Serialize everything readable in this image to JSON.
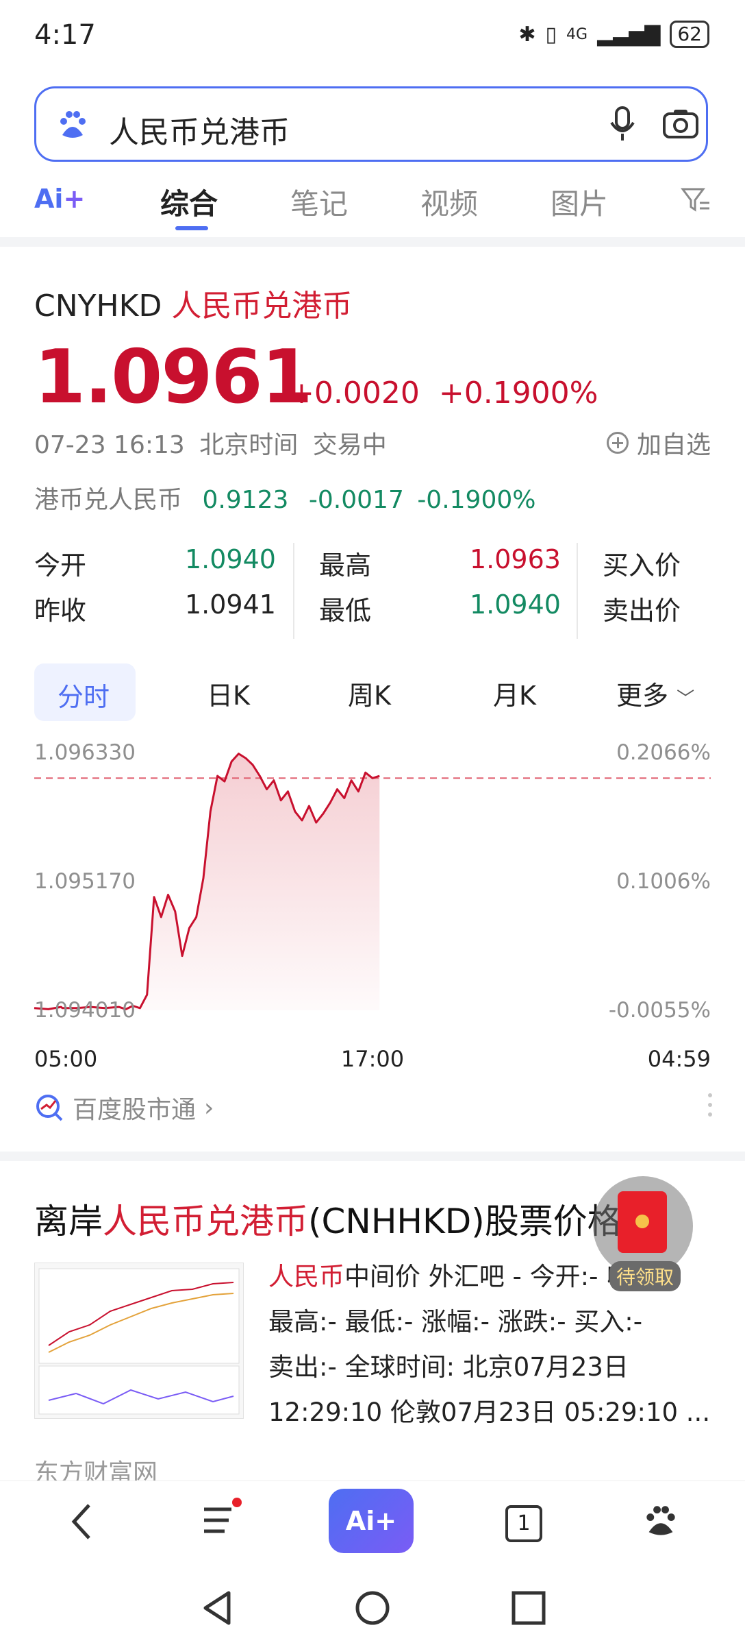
{
  "status_bar": {
    "time": "4:17",
    "network": "4G",
    "battery": "62"
  },
  "search": {
    "query": "人民币兑港币"
  },
  "tabs": [
    {
      "label": "综合",
      "active": true
    },
    {
      "label": "笔记",
      "active": false
    },
    {
      "label": "视频",
      "active": false
    },
    {
      "label": "图片",
      "active": false
    }
  ],
  "quote": {
    "code": "CNYHKD",
    "name": "人民币兑港币",
    "price": "1.0961",
    "change": "+0.0020",
    "change_pct": "+0.1900%",
    "time": "07-23 16:13",
    "tz": "北京时间",
    "status": "交易中",
    "add_watch": "加自选",
    "reverse_label": "港币兑人民币",
    "reverse_price": "0.9123",
    "reverse_change": "-0.0017",
    "reverse_change_pct": "-0.1900%"
  },
  "stats": {
    "open_label": "今开",
    "open": "1.0940",
    "prev_label": "昨收",
    "prev": "1.0941",
    "high_label": "最高",
    "high": "1.0963",
    "low_label": "最低",
    "low": "1.0940",
    "bid_label": "买入价",
    "ask_label": "卖出价"
  },
  "chart_tabs": [
    "分时",
    "日K",
    "周K",
    "月K",
    "更多"
  ],
  "chart_data": {
    "type": "line",
    "y_left_ticks": [
      "1.096330",
      "1.095170",
      "1.094010"
    ],
    "y_right_ticks": [
      "0.2066%",
      "0.1006%",
      "-0.0055%"
    ],
    "x_ticks": [
      "05:00",
      "17:00",
      "04:59"
    ],
    "ylim": [
      1.09401,
      1.09633
    ],
    "reference_line": 1.0961,
    "grid": false,
    "series": [
      {
        "x": [
          0,
          0.5,
          0.95,
          1.0,
          1.5,
          2.0,
          2.5,
          3.0,
          3.25,
          3.5,
          3.75,
          4.0,
          4.25,
          4.5,
          4.75,
          5.0,
          5.25,
          5.5,
          5.75,
          6.0,
          6.25,
          6.5,
          6.75,
          7.0,
          7.25,
          7.5,
          7.75,
          8.0,
          8.25,
          8.5,
          8.75,
          9.0,
          9.25,
          9.5,
          9.75,
          10.0,
          10.25,
          10.5,
          10.75,
          11.0,
          11.25,
          11.5,
          11.75,
          12.0,
          12.25
        ],
        "values": [
          1.09403,
          1.09402,
          1.09404,
          1.09403,
          1.09403,
          1.09404,
          1.09403,
          1.09404,
          1.09402,
          1.09405,
          1.09403,
          1.09415,
          1.09503,
          1.09485,
          1.09505,
          1.0949,
          1.0945,
          1.09475,
          1.09485,
          1.0952,
          1.0958,
          1.09612,
          1.09607,
          1.09625,
          1.09632,
          1.09628,
          1.09622,
          1.09612,
          1.096,
          1.09608,
          1.0959,
          1.09598,
          1.0958,
          1.09572,
          1.09585,
          1.0957,
          1.09578,
          1.09588,
          1.096,
          1.09592,
          1.09608,
          1.09598,
          1.09615,
          1.0961,
          1.09612
        ]
      }
    ]
  },
  "source_link": "百度股市通",
  "result": {
    "title_prefix": "离岸",
    "title_highlight": "人民币兑港币",
    "title_suffix": "(CNHHKD)股票价格",
    "ellipsis": "..",
    "body_highlight": "人民币",
    "body_line1_rest": "中间价 外汇吧 - 今开:- 收:-",
    "body_line2": "最高:- 最低:- 涨幅:- 涨跌:- 买入:-",
    "body_line3": "卖出:- 全球时间: 北京07月23日",
    "body_line4": "12:29:10 伦敦07月23日 05:29:10 ...",
    "source": "东方财富网"
  },
  "red_packet": {
    "label": "待领取"
  },
  "bottom_nav": {
    "ai_label": "Ai+",
    "tab_count": "1"
  },
  "colors": {
    "accent": "#4e6ef2",
    "up": "#c8102e",
    "down": "#138a62"
  }
}
